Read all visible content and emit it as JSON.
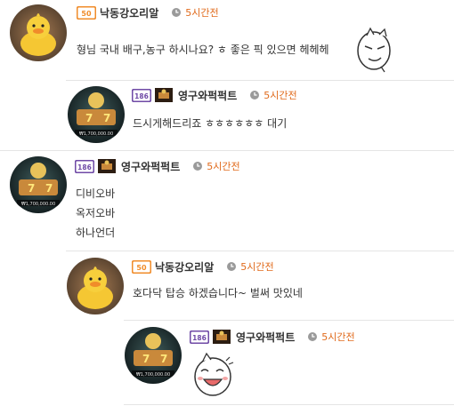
{
  "comments": [
    {
      "level": "lv.50",
      "nick": "낙동강오리알",
      "time": "5시간전",
      "lines": [
        "형님 국내 배구,농구 하시나요? ㅎ 좋은 픽 있으면 헤헤헤"
      ],
      "emoticon": "smirk-face-icon"
    },
    {
      "level": "lv.186",
      "nick": "영구와퍽퍽트",
      "time": "5시간전",
      "lines": [
        "드시게해드리죠 ㅎㅎㅎㅎㅎㅎ 대기"
      ]
    },
    {
      "level": "lv.186",
      "nick": "영구와퍽퍽트",
      "time": "5시간전",
      "lines": [
        "디비오바",
        "옥저오바",
        "하나언더"
      ]
    },
    {
      "level": "lv.50",
      "nick": "낙동강오리알",
      "time": "5시간전",
      "lines": [
        "호다닥 탑승 하겠습니다~ 벌써 맛있네"
      ]
    },
    {
      "level": "lv.186",
      "nick": "영구와퍽퍽트",
      "time": "5시간전",
      "lines": [
        ""
      ],
      "emoticon": "laughing-face-icon"
    }
  ],
  "colors": {
    "time": "#e06a1b",
    "divider": "#e5e5e5",
    "level_orange": "#f08c2a",
    "level_purple": "#6f4aa6"
  }
}
